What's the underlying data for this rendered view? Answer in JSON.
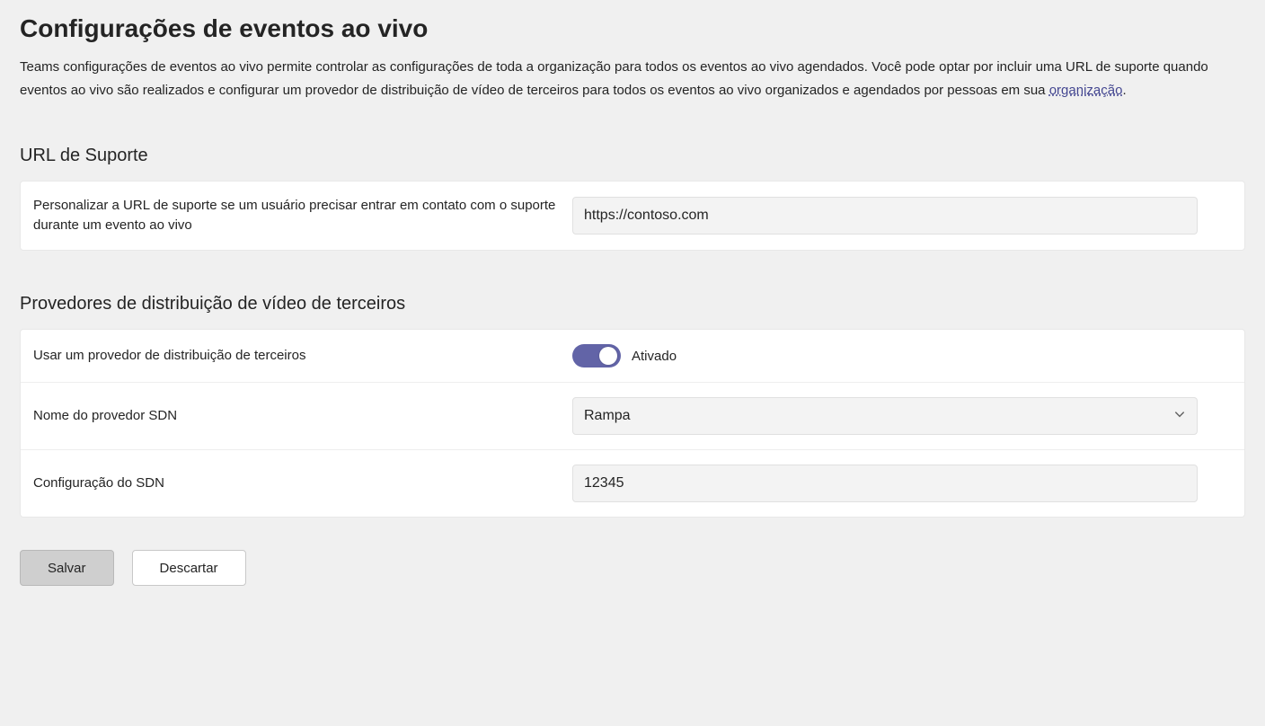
{
  "page": {
    "title": "Configurações de eventos ao vivo",
    "description_pre": "Teams configurações de eventos ao vivo permite controlar as configurações de toda a organização para todos os eventos ao vivo agendados. Você pode optar por incluir uma URL de suporte quando eventos ao vivo são realizados e configurar um provedor de distribuição de vídeo de terceiros para todos os eventos ao vivo organizados e agendados por pessoas em sua ",
    "description_link": "organização",
    "description_post": "."
  },
  "support": {
    "section_title": "URL de Suporte",
    "label": "Personalizar a URL de suporte se um usuário precisar entrar em contato com o suporte durante um evento ao vivo",
    "value": "https://contoso.com"
  },
  "providers": {
    "section_title": "Provedores de distribuição de vídeo de terceiros",
    "use_provider_label": "Usar um provedor de distribuição de terceiros",
    "toggle_state": "Ativado",
    "sdn_name_label": "Nome do provedor SDN",
    "sdn_name_value": "Rampa",
    "sdn_config_label": "Configuração do SDN",
    "sdn_config_value": "12345"
  },
  "footer": {
    "save": "Salvar",
    "discard": "Descartar"
  }
}
